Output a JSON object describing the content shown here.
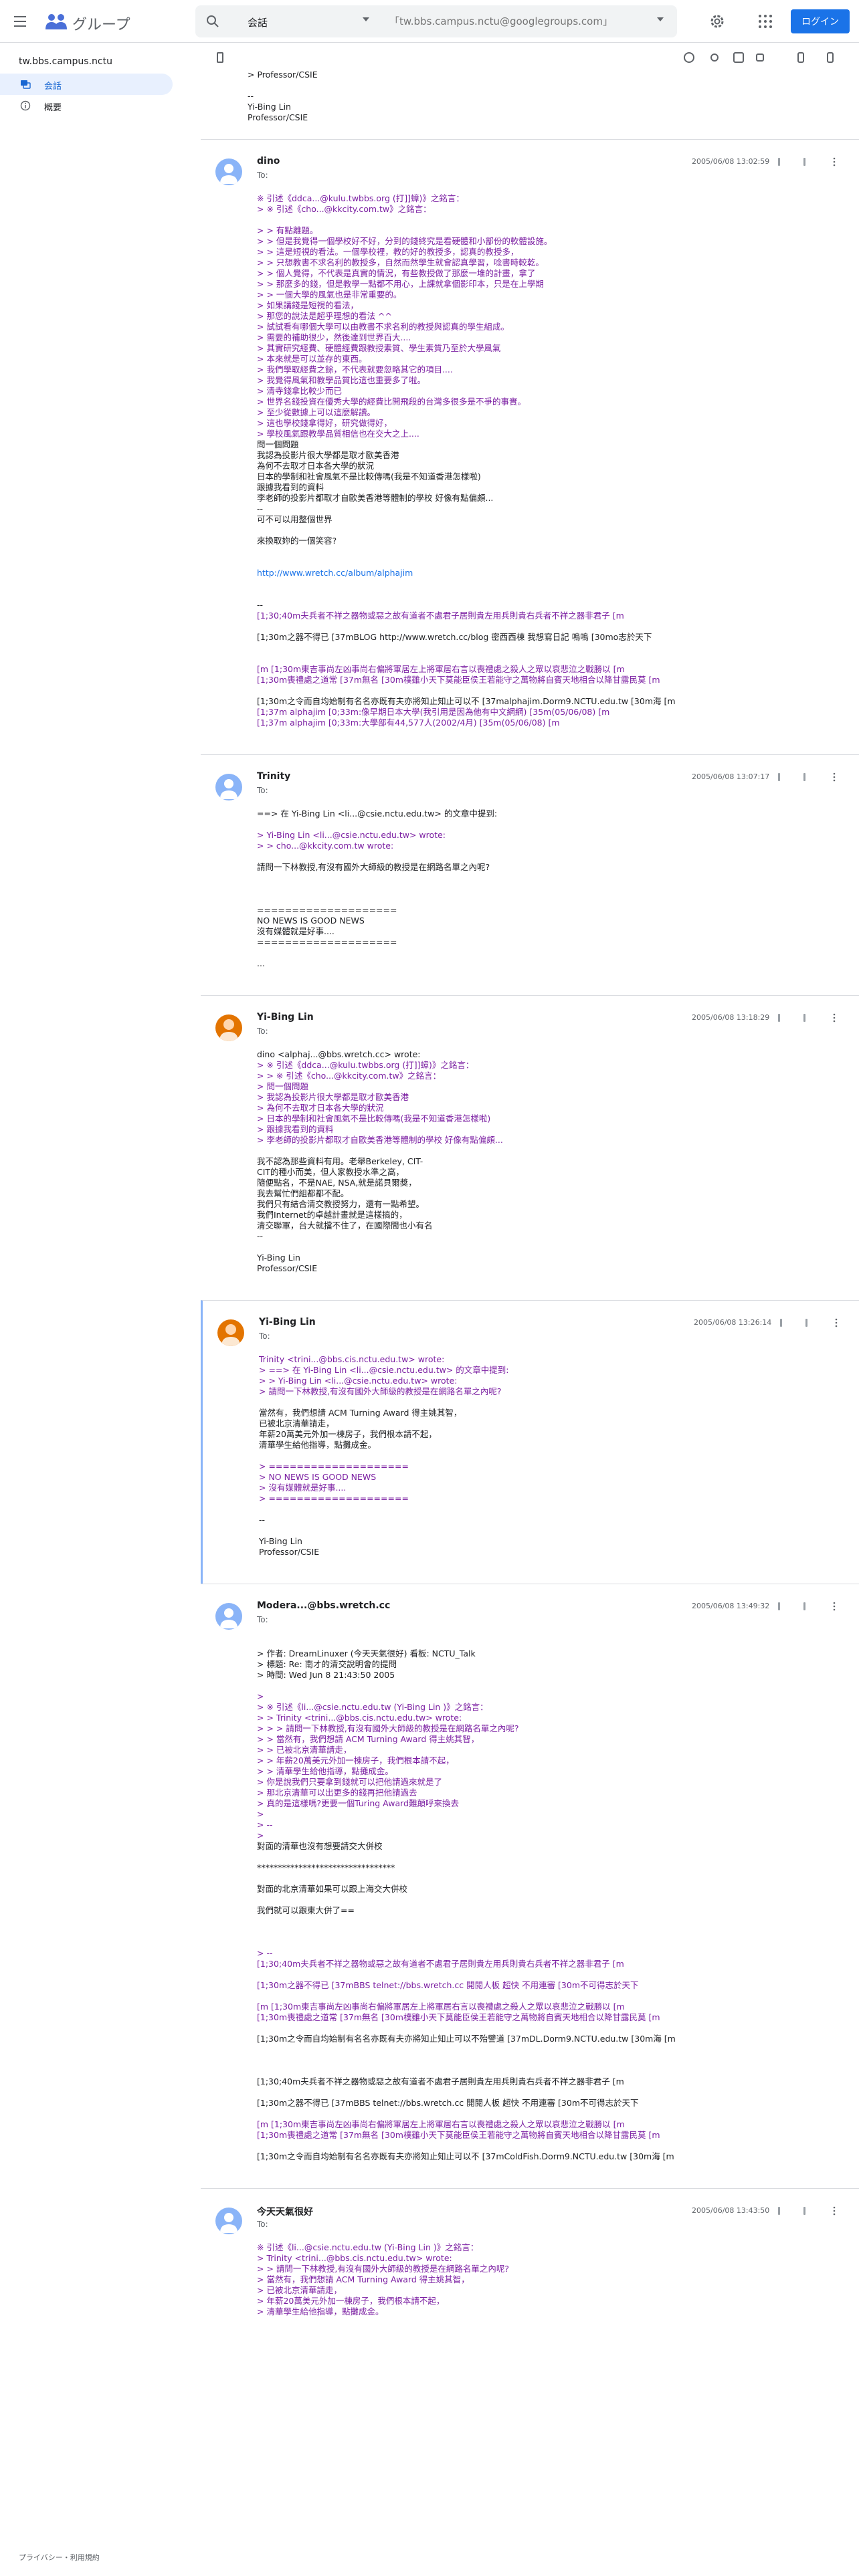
{
  "app": {
    "name": "グループ"
  },
  "search": {
    "scope": "会話",
    "placeholder": "「tw.bbs.campus.nctu@googlegroups.com」"
  },
  "header": {
    "login_label": "ログイン"
  },
  "sidebar": {
    "group": "tw.bbs.campus.nctu",
    "items": [
      {
        "label": "会話"
      },
      {
        "label": "概要"
      }
    ]
  },
  "footer": {
    "links": "プライバシー・利用規約"
  },
  "prev_tail": [
    "> Professor/CSIE",
    "",
    "--",
    "Yi-Bing Lin",
    "Professor/CSIE"
  ],
  "posts": [
    {
      "author": "dino",
      "to": "To:",
      "date": "2005/06/08 13:02:59",
      "lines": [
        [
          "※ 引述《ddca...@kulu.twbbs.org (打]]蟑)》之銘言：",
          "q"
        ],
        [
          "> ※ 引述《cho...@kkcity.com.tw》之銘言：",
          "q"
        ],
        [
          "",
          ""
        ],
        [
          "> > 有點離題。",
          "q"
        ],
        [
          "> > 但是我覺得一個學校好不好，分到的錢終究是看硬體和小部份的軟體設施。",
          "q"
        ],
        [
          "> > 這是短視的看法。一個學校裡，教的好的教授多，認真的教授多，",
          "q"
        ],
        [
          "> > 只想教書不求名利的教授多，自然而然學生就會認真學習，唸書時較乾。",
          "q"
        ],
        [
          "> > 個人覺得，不代表是真實的情況，有些教授做了那麼一堆的計畫，拿了",
          "q"
        ],
        [
          "> > 那麼多的錢，但是教學一點都不用心，上課就拿個影印本，只是在上學期",
          "q"
        ],
        [
          "> > 一個大學的風氣也是非常重要的。",
          "q"
        ],
        [
          "> 如果講錢是短視的看法，",
          "q"
        ],
        [
          "> 那您的說法是超乎理想的看法 ^^",
          "q"
        ],
        [
          "> 試試看有哪個大學可以由教書不求名利的教授與認真的學生組成。",
          "q"
        ],
        [
          "> 需要的補助很少，然後達到世界百大....",
          "q"
        ],
        [
          "> 其實研究經費、硬體經費跟教授素質、學生素質乃至於大學風氣",
          "q"
        ],
        [
          "> 本來就是可以並存的東西。",
          "q"
        ],
        [
          "> 我們學取經費之餘，不代表就要忽略其它的項目....",
          "q"
        ],
        [
          "> 我覺得風氣和教學品質比這也重要多了啦。",
          "q"
        ],
        [
          "> 清寺錢拿比較少而已",
          "q"
        ],
        [
          "> 世界名錢投資在優秀大學的經費比開飛段的台灣多很多是不爭的事實。",
          "q"
        ],
        [
          "> 至少從數據上可以這麼解讀。",
          "q"
        ],
        [
          "> 這也學校錢拿得好，研究做得好，",
          "q"
        ],
        [
          "> 學校風氣跟教學品質相信也在交大之上....",
          "q"
        ],
        [
          "問一個問題",
          ""
        ],
        [
          "我認為投影片很大學都是取才歐美香港",
          ""
        ],
        [
          "為何不去取才日本各大學的狀況",
          ""
        ],
        [
          "日本的學制和社會風氣不是比較傳嗎(我是不知道香港怎樣啦)",
          ""
        ],
        [
          "跟據我看到的資料",
          ""
        ],
        [
          "李老師的投影片都取才自歐美香港等體制的學校 好像有點偏頗...",
          ""
        ],
        [
          "--",
          ""
        ],
        [
          "可不可以用整個世界",
          ""
        ],
        [
          "",
          ""
        ],
        [
          "來換取妳的一個笑容?",
          ""
        ],
        [
          "",
          ""
        ],
        [
          "",
          ""
        ],
        [
          "http://www.wretch.cc/album/alphajim",
          "ln"
        ],
        [
          "",
          ""
        ],
        [
          "",
          ""
        ],
        [
          "--",
          ""
        ],
        [
          "[1;30;40m夫兵者不祥之器物或惡之故有道者不處君子居則貴左用兵則貴右兵者不祥之器非君子 [m",
          "tr"
        ],
        [
          "",
          ""
        ],
        [
          "[1;30m之器不得已 [37mBLOG http://www.wretch.cc/blog 密西西棟 我想寫日記 嗚嗚 [30mo志於天下",
          ""
        ],
        [
          "",
          ""
        ],
        [
          "",
          ""
        ],
        [
          "[m [1;30m東吉事尚左凶事尚右偏將軍居左上將軍居右言以喪禮處之殺人之眾以哀悲泣之戰勝以 [m",
          "tr"
        ],
        [
          "[1;30m喪禮處之道常 [37m無名 [30m樸雖小天下莫能臣侯王若能守之萬物將自賓天地相合以降甘露民莫 [m",
          "tr"
        ],
        [
          "",
          ""
        ],
        [
          "[1;30m之令而自均始制有名名亦既有夫亦將知止知止可以不 [37malphajim.Dorm9.NCTU.edu.tw [30m海 [m",
          ""
        ],
        [
          "[1;37m alphajim [0;33m:像早期日本大學(我引用是因為他有中文網網) [35m(05/06/08) [m",
          "tr"
        ],
        [
          "[1;37m alphajim [0;33m:大學部有44,577人(2002/4月) [35m(05/06/08) [m",
          "tr"
        ]
      ]
    },
    {
      "author": "Trinity",
      "to": "To:",
      "date": "2005/06/08 13:07:17",
      "lines": [
        [
          "==> 在 Yi-Bing Lin <li...@csie.nctu.edu.tw> 的文章中提到:",
          ""
        ],
        [
          "",
          ""
        ],
        [
          "> Yi-Bing Lin <li...@csie.nctu.edu.tw> wrote:",
          "q"
        ],
        [
          "> > cho...@kkcity.com.tw wrote:",
          "q"
        ],
        [
          "",
          ""
        ],
        [
          "請問一下林教授,有沒有國外大師級的教授是在網路名單之內呢?",
          ""
        ],
        [
          "",
          ""
        ],
        [
          "",
          ""
        ],
        [
          "",
          ""
        ],
        [
          "====================",
          ""
        ],
        [
          "NO NEWS IS GOOD NEWS",
          ""
        ],
        [
          "沒有媒體就是好事....",
          ""
        ],
        [
          "====================",
          ""
        ],
        [
          "",
          ""
        ],
        [
          "...",
          ""
        ]
      ]
    },
    {
      "author": "Yi-Bing Lin",
      "to": "To:",
      "date": "2005/06/08 13:18:29",
      "lines": [
        [
          "dino <alphaj...@bbs.wretch.cc> wrote:",
          ""
        ],
        [
          "> ※ 引述《ddca...@kulu.twbbs.org (打]]蟑)》之銘言：",
          "q"
        ],
        [
          "> > ※ 引述《cho...@kkcity.com.tw》之銘言：",
          "q"
        ],
        [
          "> 問一個問題",
          "q"
        ],
        [
          "> 我認為投影片很大學都是取才歐美香港",
          "q"
        ],
        [
          "> 為何不去取才日本各大學的狀況",
          "q"
        ],
        [
          "> 日本的學制和社會風氣不是比較傳嗎(我是不知道香港怎樣啦)",
          "q"
        ],
        [
          "> 跟據我看到的資料",
          "q"
        ],
        [
          "> 李老師的投影片都取才自歐美香港等體制的學校 好像有點偏頗...",
          "q"
        ],
        [
          "",
          ""
        ],
        [
          "我不認為那些資料有用。老舉Berkeley, CIT-",
          ""
        ],
        [
          "CIT的種小而美，但人家教授水準之高，",
          ""
        ],
        [
          "隨便點名，不是NAE, NSA,就是諾貝爾獎，",
          ""
        ],
        [
          "我去幫忙們組都都不配。",
          ""
        ],
        [
          "我們只有結合清交教授努力，還有一點希望。",
          ""
        ],
        [
          "我們Internet的卓越計畫就是這樣搞的，",
          ""
        ],
        [
          "清交聯軍，台大就擋不住了，在國際間也小有名",
          ""
        ],
        [
          "--",
          ""
        ],
        [
          "",
          ""
        ],
        [
          "Yi-Bing Lin",
          ""
        ],
        [
          "Professor/CSIE",
          ""
        ]
      ]
    },
    {
      "author": "Yi-Bing Lin",
      "to": "To:",
      "date": "2005/06/08 13:26:14",
      "lines": [
        [
          "Trinity <trini...@bbs.cis.nctu.edu.tw> wrote:",
          "q"
        ],
        [
          "> ==> 在 Yi-Bing Lin <li...@csie.nctu.edu.tw> 的文章中提到:",
          "q"
        ],
        [
          "> > Yi-Bing Lin <li...@csie.nctu.edu.tw> wrote:",
          "q"
        ],
        [
          "> 請問一下林教授,有沒有國外大師級的教授是在網路名單之內呢?",
          "q"
        ],
        [
          "",
          ""
        ],
        [
          "當然有，我們想請 ACM Turning Award 得主姚其智，",
          ""
        ],
        [
          "已被北京清華請走，",
          ""
        ],
        [
          "年薪20萬美元外加一棟房子，我們根本請不起，",
          ""
        ],
        [
          "清華學生給他指導，點攤成金。",
          ""
        ],
        [
          "",
          ""
        ],
        [
          "> ====================",
          "q"
        ],
        [
          "> NO NEWS IS GOOD NEWS",
          "q"
        ],
        [
          "> 沒有媒體就是好事....",
          "q"
        ],
        [
          "> ====================",
          "q"
        ],
        [
          "",
          ""
        ],
        [
          "--",
          ""
        ],
        [
          "",
          ""
        ],
        [
          "Yi-Bing Lin",
          ""
        ],
        [
          "Professor/CSIE",
          ""
        ]
      ]
    },
    {
      "author": "Modera...@bbs.wretch.cc",
      "to": "To:",
      "date": "2005/06/08 13:49:32",
      "lines": [
        [
          "",
          ""
        ],
        [
          "> 作者: DreamLinuxer (今天天氣很好) 看板: NCTU_Talk",
          ""
        ],
        [
          "> 標題: Re: 南才的清交說明會的提問",
          ""
        ],
        [
          "> 時間: Wed Jun 8 21:43:50 2005",
          ""
        ],
        [
          "",
          ""
        ],
        [
          ">",
          "q"
        ],
        [
          "> ※ 引述《li...@csie.nctu.edu.tw (Yi-Bing Lin )》之銘言：",
          "q"
        ],
        [
          "> > Trinity <trini...@bbs.cis.nctu.edu.tw> wrote:",
          "q"
        ],
        [
          "> > > 請問一下林教授,有沒有國外大師級的教授是在網路名單之內呢?",
          "q"
        ],
        [
          "> > 當然有，我們想請 ACM Turning Award 得主姚其智，",
          "q"
        ],
        [
          "> > 已被北京清華請走，",
          "q"
        ],
        [
          "> > 年薪20萬美元外加一棟房子，我們根本請不起，",
          "q"
        ],
        [
          "> > 清華學生給他指導，點攤成金。",
          "q"
        ],
        [
          "> 你是說我們只要拿到錢就可以把他請過來就是了",
          "q"
        ],
        [
          "> 那北京清華可以出更多的錢再把他請過去",
          "q"
        ],
        [
          "> 真的是這樣嗎?更要一個Turing Award難顛呼來換去",
          "q"
        ],
        [
          ">",
          "q"
        ],
        [
          "> --",
          "q"
        ],
        [
          ">",
          "q"
        ],
        [
          "對面的清華也沒有想要請交大併校",
          ""
        ],
        [
          "",
          ""
        ],
        [
          "*********************************",
          ""
        ],
        [
          "",
          ""
        ],
        [
          "對面的北京清華如果可以跟上海交大併校",
          ""
        ],
        [
          "",
          ""
        ],
        [
          "我們就可以跟東大併了==",
          ""
        ],
        [
          "",
          ""
        ],
        [
          "",
          ""
        ],
        [
          "",
          ""
        ],
        [
          "> --",
          "q"
        ],
        [
          "[1;30;40m夫兵者不祥之器物或惡之故有道者不處君子居則貴左用兵則貴右兵者不祥之器非君子 [m",
          "tr"
        ],
        [
          "",
          ""
        ],
        [
          "[1;30m之器不得已 [37mBBS telnet://bbs.wretch.cc 開閱人板 超快 不用連審 [30m不可得志於天下",
          "tr"
        ],
        [
          "",
          ""
        ],
        [
          "[m [1;30m東吉事尚左凶事尚右偏將軍居左上將軍居右言以喪禮處之殺人之眾以哀悲泣之戰勝以 [m",
          "tr"
        ],
        [
          "[1;30m喪禮處之道常 [37m無名 [30m樸雖小天下莫能臣侯王若能守之萬物將自賓天地相合以降甘露民莫 [m",
          "tr"
        ],
        [
          "",
          ""
        ],
        [
          "[1;30m之令而自均始制有名名亦既有夫亦將知止知止可以不殆譬道 [37mDL.Dorm9.NCTU.edu.tw [30m海 [m",
          ""
        ],
        [
          "",
          ""
        ],
        [
          "",
          ""
        ],
        [
          "",
          ""
        ],
        [
          "[1;30;40m夫兵者不祥之器物或惡之故有道者不處君子居則貴左用兵則貴右兵者不祥之器非君子 [m",
          ""
        ],
        [
          "",
          ""
        ],
        [
          "[1;30m之器不得已 [37mBBS telnet://bbs.wretch.cc 開閱人板 超快 不用連審 [30m不可得志於天下",
          ""
        ],
        [
          "",
          ""
        ],
        [
          "[m [1;30m東吉事尚左凶事尚右偏將軍居左上將軍居右言以喪禮處之殺人之眾以哀悲泣之戰勝以 [m",
          "tr"
        ],
        [
          "[1;30m喪禮處之道常 [37m無名 [30m樸雖小天下莫能臣侯王若能守之萬物將自賓天地相合以降甘露民莫 [m",
          "tr"
        ],
        [
          "",
          ""
        ],
        [
          "[1;30m之令而自均始制有名名亦既有夫亦將知止知止可以不 [37mColdFish.Dorm9.NCTU.edu.tw [30m海 [m",
          ""
        ]
      ]
    },
    {
      "author": "今天天氣很好",
      "to": "To:",
      "date": "2005/06/08 13:43:50",
      "lines": [
        [
          "※ 引述《li...@csie.nctu.edu.tw (Yi-Bing Lin )》之銘言：",
          "q"
        ],
        [
          "> Trinity <trini...@bbs.cis.nctu.edu.tw> wrote:",
          "q"
        ],
        [
          "> > 請問一下林教授,有沒有國外大師級的教授是在網路名單之內呢?",
          "q"
        ],
        [
          "> 當然有，我們想請 ACM Turning Award 得主姚其智，",
          "q"
        ],
        [
          "> 已被北京清華請走，",
          "q"
        ],
        [
          "> 年薪20萬美元外加一棟房子，我們根本請不起，",
          "q"
        ],
        [
          "> 清華學生給他指導，點攤成金。",
          "q"
        ]
      ]
    }
  ]
}
